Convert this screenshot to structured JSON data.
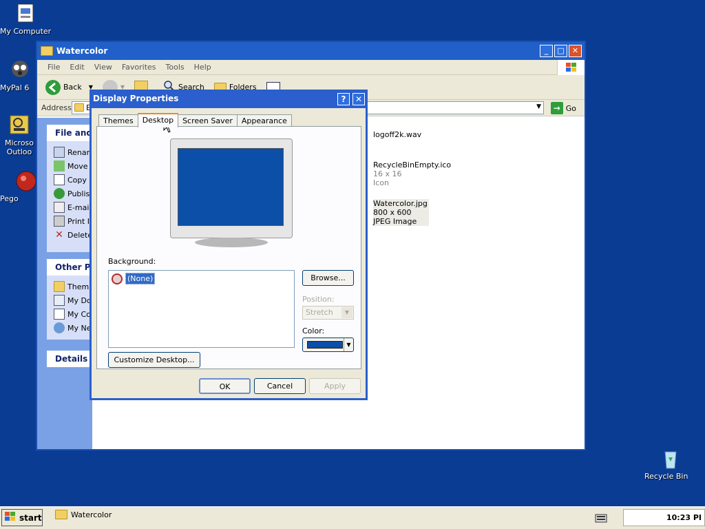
{
  "desktop": {
    "icons": [
      {
        "label": "My Computer",
        "icon": "computer-icon"
      },
      {
        "label": "MyPal 6",
        "icon": "mypal-icon"
      },
      {
        "label": "Microso Outloo",
        "icon": "outlook-icon"
      },
      {
        "label": "Pego",
        "icon": "pego-icon"
      },
      {
        "label": "Recycle Bin",
        "icon": "recycle-bin-icon"
      }
    ]
  },
  "explorer": {
    "title": "Watercolor",
    "menu": [
      "File",
      "Edit",
      "View",
      "Favorites",
      "Tools",
      "Help"
    ],
    "toolbar": {
      "back": "Back",
      "search": "Search",
      "folders": "Folders"
    },
    "address": {
      "label": "Address",
      "value": "E",
      "go": "Go"
    },
    "panels": {
      "file_tasks": {
        "heading": "File and F",
        "items": [
          "Renar",
          "Move",
          "Copy",
          "Publis",
          "E-mai",
          "Print I",
          "Delete"
        ]
      },
      "other_places": {
        "heading": "Other Pla",
        "items": [
          "Them",
          "My Do",
          "My Co",
          "My Ne"
        ]
      },
      "details": {
        "heading": "Details"
      }
    },
    "files": [
      {
        "name": "logoff2k.wav"
      },
      {
        "name": "RecycleBinEmpty.ico",
        "line2": "16 x 16",
        "line3": "Icon"
      },
      {
        "name": "Watercolor.jpg",
        "line2": "800 x 600",
        "line3": "JPEG Image"
      }
    ]
  },
  "dialog": {
    "title": "Display Properties",
    "help": "?",
    "close": "X",
    "tabs": [
      "Themes",
      "Desktop",
      "Screen Saver",
      "Appearance"
    ],
    "active_tab": "Desktop",
    "background_label": "Background:",
    "background_items": [
      "(None)"
    ],
    "browse": "Browse...",
    "position_label": "Position:",
    "position_value": "Stretch",
    "color_label": "Color:",
    "color_value": "#0b4fa8",
    "customize": "Customize Desktop...",
    "ok": "OK",
    "cancel": "Cancel",
    "apply": "Apply"
  },
  "taskbar": {
    "start": "start",
    "task": "Watercolor",
    "clock": "10:23 PI"
  }
}
